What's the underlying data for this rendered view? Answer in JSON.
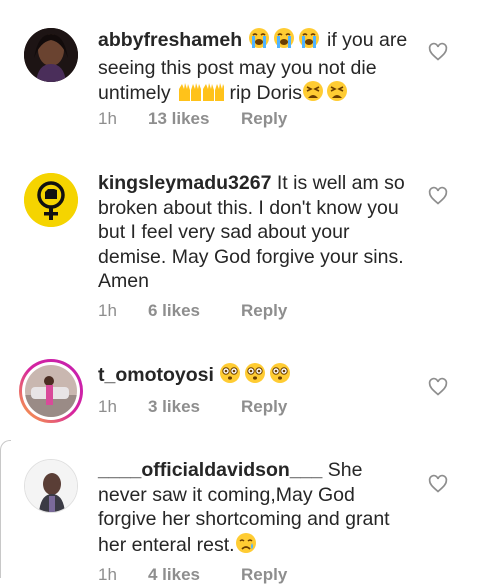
{
  "comments": [
    {
      "username": "abbyfreshameh",
      "text_a": " if you are seeing this  post may you not die untimely ",
      "text_b": " rip Doris",
      "time": "1h",
      "likes": "13 likes",
      "reply": "Reply"
    },
    {
      "username": "kingsleymadu3267",
      "text": " It is well am so broken about this. I don't know you but I feel very sad about your demise. May God forgive your sins. Amen",
      "time": "1h",
      "likes": "6 likes",
      "reply": "Reply"
    },
    {
      "username": "t_omotoyosi",
      "text": " ",
      "time": "1h",
      "likes": "3 likes",
      "reply": "Reply"
    },
    {
      "username": "____officialdavidson___",
      "text": " She never saw it coming,May God forgive her shortcoming and grant her enteral rest.",
      "time": "1h",
      "likes": "4 likes",
      "reply": "Reply"
    }
  ],
  "colors": {
    "text": "#262626",
    "meta": "#8e8e8e",
    "story_ring": "#d6249f",
    "avatar_yellow": "#f5d400"
  },
  "icons": [
    "heart-outline-icon",
    "loudly-crying-face-emoji",
    "raising-hands-emoji",
    "weary-face-emoji",
    "flushed-face-emoji",
    "crying-face-emoji",
    "female-fist-symbol-icon"
  ]
}
